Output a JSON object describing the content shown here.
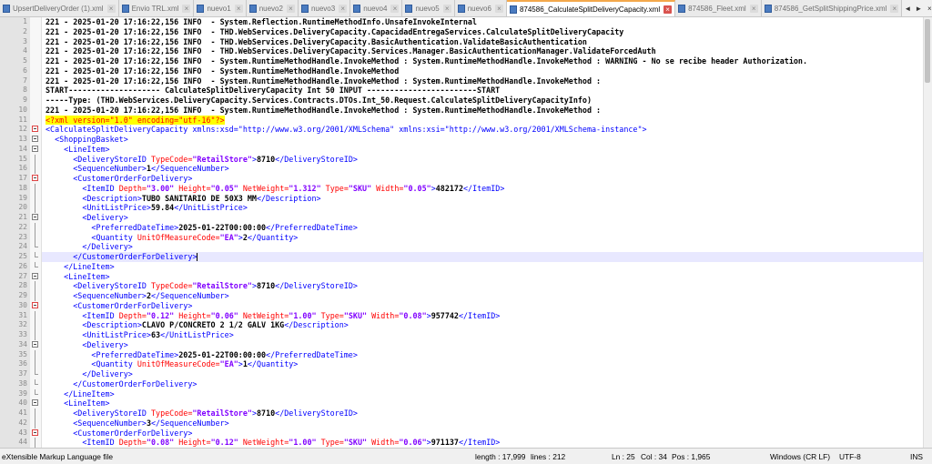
{
  "tabs": [
    {
      "label": "UpsertDeliveryOrder (1).xml",
      "active": false
    },
    {
      "label": "Envio TRL.xml",
      "active": false
    },
    {
      "label": "nuevo1",
      "active": false
    },
    {
      "label": "nuevo2",
      "active": false
    },
    {
      "label": "nuevo3",
      "active": false
    },
    {
      "label": "nuevo4",
      "active": false
    },
    {
      "label": "nuevo5",
      "active": false
    },
    {
      "label": "nuevo6",
      "active": false
    },
    {
      "label": "874586_CalculateSplitDeliveryCapacity.xml",
      "active": true
    },
    {
      "label": "874586_Fleet.xml",
      "active": false
    },
    {
      "label": "874586_GetSplitShippingPrice.xml",
      "active": false
    }
  ],
  "tab_close_glyph": "×",
  "tab_nav": {
    "prev": "◄",
    "next": "►",
    "close": "×"
  },
  "colors": {
    "tag": "#0000ff",
    "attr": "#ff0000",
    "value": "#8000ff",
    "active_tab_accent": "#f3a84b"
  },
  "log_lines": [
    "221 - 2025-01-20 17:16:22,156 INFO  - System.Reflection.RuntimeMethodInfo.UnsafeInvokeInternal",
    "221 - 2025-01-20 17:16:22,156 INFO  - THD.WebServices.DeliveryCapacity.CapacidadEntregaServices.CalculateSplitDeliveryCapacity",
    "221 - 2025-01-20 17:16:22,156 INFO  - THD.WebServices.DeliveryCapacity.BasicAuthentication.ValidateBasicAuthentication",
    "221 - 2025-01-20 17:16:22,156 INFO  - THD.WebServices.DeliveryCapacity.Services.Manager.BasicAuthenticationManager.ValidateForcedAuth",
    "221 - 2025-01-20 17:16:22,156 INFO  - System.RuntimeMethodHandle.InvokeMethod : System.RuntimeMethodHandle.InvokeMethod : WARNING - No se recibe header Authorization.",
    "221 - 2025-01-20 17:16:22,156 INFO  - System.RuntimeMethodHandle.InvokeMethod",
    "221 - 2025-01-20 17:16:22,156 INFO  - System.RuntimeMethodHandle.InvokeMethod : System.RuntimeMethodHandle.InvokeMethod :",
    "START-------------------- CalculateSplitDeliveryCapacity Int 50 INPUT ------------------------START",
    "-----Type: (THD.WebServices.DeliveryCapacity.Services.Contracts.DTOs.Int_50.Request.CalculateSplitDeliveryCapacityInfo)",
    "221 - 2025-01-20 17:16:22,156 INFO  - System.RuntimeMethodHandle.InvokeMethod : System.RuntimeMethodHandle.InvokeMethod :"
  ],
  "xml": {
    "decl": "<?xml version=\"1.0\" encoding=\"utf-16\"?>",
    "root_open": "<CalculateSplitDeliveryCapacity xmlns:xsd=\"http://www.w3.org/2001/XMLSchema\" xmlns:xsi=\"http://www.w3.org/2001/XMLSchema-instance\">",
    "basket_open": "<ShoppingBasket>",
    "items": [
      {
        "store": "8710",
        "seq": "1",
        "depth": "3.00",
        "height": "0.05",
        "weight": "1.312",
        "type": "SKU",
        "width": "0.05",
        "item_id": "482172",
        "desc": "TUBO SANITARIO DE 50X3 MM",
        "price": "59.84",
        "date": "2025-01-22T00:00:00",
        "uom": "EA",
        "qty": "2"
      },
      {
        "store": "8710",
        "seq": "2",
        "depth": "0.12",
        "height": "0.06",
        "weight": "1.00",
        "type": "SKU",
        "width": "0.08",
        "item_id": "957742",
        "desc": "CLAVO P/CONCRETO 2 1/2 GALV 1KG",
        "price": "63",
        "date": "2025-01-22T00:00:00",
        "uom": "EA",
        "qty": "1"
      },
      {
        "store": "8710",
        "seq": "3",
        "depth": "0.08",
        "height": "0.12",
        "weight": "1.00",
        "type": "SKU",
        "width": "0.06",
        "item_id": "971137"
      }
    ]
  },
  "status": {
    "file_type": "eXtensible Markup Language file",
    "length": "length : 17,999",
    "lines": "lines : 212",
    "ln": "Ln : 25",
    "col": "Col : 34",
    "pos": "Pos : 1,965",
    "eol": "Windows (CR LF)",
    "encoding": "UTF-8",
    "mode": "INS"
  }
}
